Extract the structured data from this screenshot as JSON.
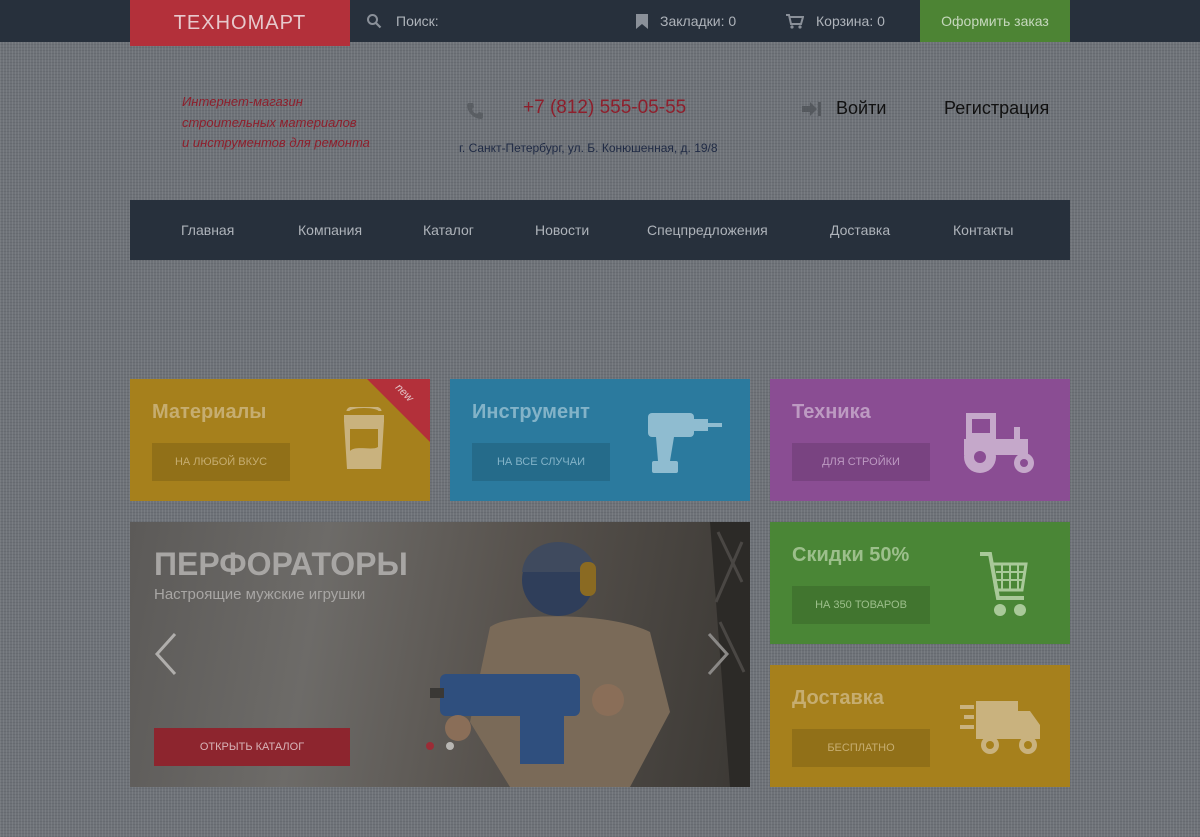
{
  "topbar": {
    "logo": "ТЕХНОМАРТ",
    "search_label": "Поиск:",
    "bookmarks": "Закладки: 0",
    "cart": "Корзина: 0",
    "order_button": "Оформить заказ",
    "icons": {
      "search": "search-icon",
      "bookmark": "bookmark-icon",
      "cart": "cart-icon"
    }
  },
  "header": {
    "tagline": [
      "Интернет-магазин",
      "строительных материалов",
      "и инструментов для ремонта"
    ],
    "phone": "+7 (812) 555-05-55",
    "address": "г. Санкт-Петербург, ул. Б. Конюшенная, д. 19/8",
    "login": "Войти",
    "register": "Регистрация"
  },
  "nav": {
    "items": [
      "Главная",
      "Компания",
      "Каталог",
      "Новости",
      "Спецпредложения",
      "Доставка",
      "Контакты"
    ]
  },
  "tiles": [
    {
      "title": "Материалы",
      "button": "на любой вкус",
      "badge": "new",
      "icon": "paint-bucket-icon",
      "color": "#a6801c"
    },
    {
      "title": "Инструмент",
      "button": "на все случаи",
      "icon": "drill-icon",
      "color": "#2b7a9e"
    },
    {
      "title": "Техника",
      "button": "для стройки",
      "icon": "tractor-icon",
      "color": "#8a4d93"
    },
    {
      "title": "Скидки 50%",
      "button": "на 350 товаров",
      "icon": "shopping-cart-icon",
      "color": "#4a8636"
    },
    {
      "title": "Доставка",
      "button": "бесплатно",
      "icon": "delivery-truck-icon",
      "color": "#a6801c"
    }
  ],
  "slider": {
    "title": "ПЕРФОРАТОРЫ",
    "subtitle": "Настроящие мужские игрушки",
    "button": "Открыть каталог",
    "active_slide": 1,
    "slide_count": 2
  },
  "colors": {
    "dark": "#27303c",
    "logo_red": "#b3303a",
    "order_green": "#4d8434",
    "accent_red": "#8e1f2c"
  }
}
